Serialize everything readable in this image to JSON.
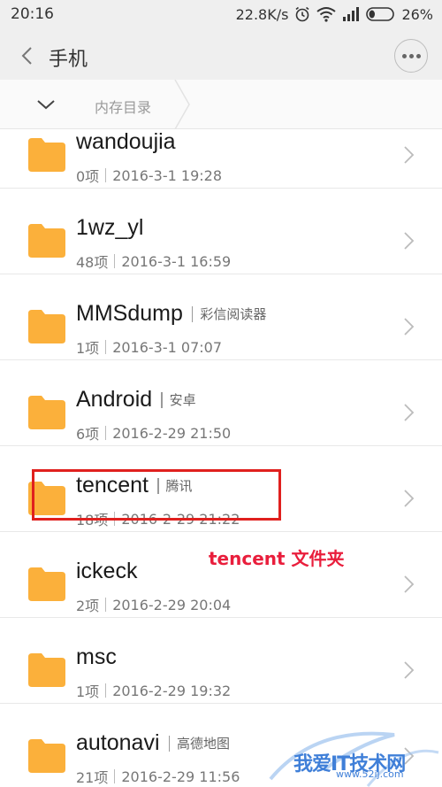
{
  "status_bar": {
    "time": "20:16",
    "network_speed": "22.8K/s",
    "battery_percent": "26%",
    "battery_level": 0.26,
    "icons": [
      "alarm-icon",
      "wifi-icon",
      "signal-icon",
      "battery-icon"
    ]
  },
  "header": {
    "title": "手机"
  },
  "breadcrumb": {
    "current": "内存目录"
  },
  "folders": [
    {
      "name": "wandoujia",
      "tag": "",
      "count": "0项",
      "date": "2016-3-1 19:28"
    },
    {
      "name": "1wz_yl",
      "tag": "",
      "count": "48项",
      "date": "2016-3-1 16:59"
    },
    {
      "name": "MMSdump",
      "tag": "彩信阅读器",
      "count": "1项",
      "date": "2016-3-1 07:07"
    },
    {
      "name": "Android",
      "tag": "安卓",
      "count": "6项",
      "date": "2016-2-29 21:50"
    },
    {
      "name": "tencent",
      "tag": "腾讯",
      "count": "18项",
      "date": "2016-2-29 21:22"
    },
    {
      "name": "ickeck",
      "tag": "",
      "count": "2项",
      "date": "2016-2-29 20:04"
    },
    {
      "name": "msc",
      "tag": "",
      "count": "1项",
      "date": "2016-2-29 19:32"
    },
    {
      "name": "autonavi",
      "tag": "高德地图",
      "count": "21项",
      "date": "2016-2-29 11:56"
    }
  ],
  "annotation": {
    "text": "tencent 文件夹",
    "color": "#e91e3c"
  },
  "watermark": {
    "text": "我爱IT技术网",
    "url": "www.52ij.com"
  },
  "colors": {
    "folder": "#fbb03b",
    "highlight": "#e0201e",
    "bar_background": "#efefef"
  }
}
